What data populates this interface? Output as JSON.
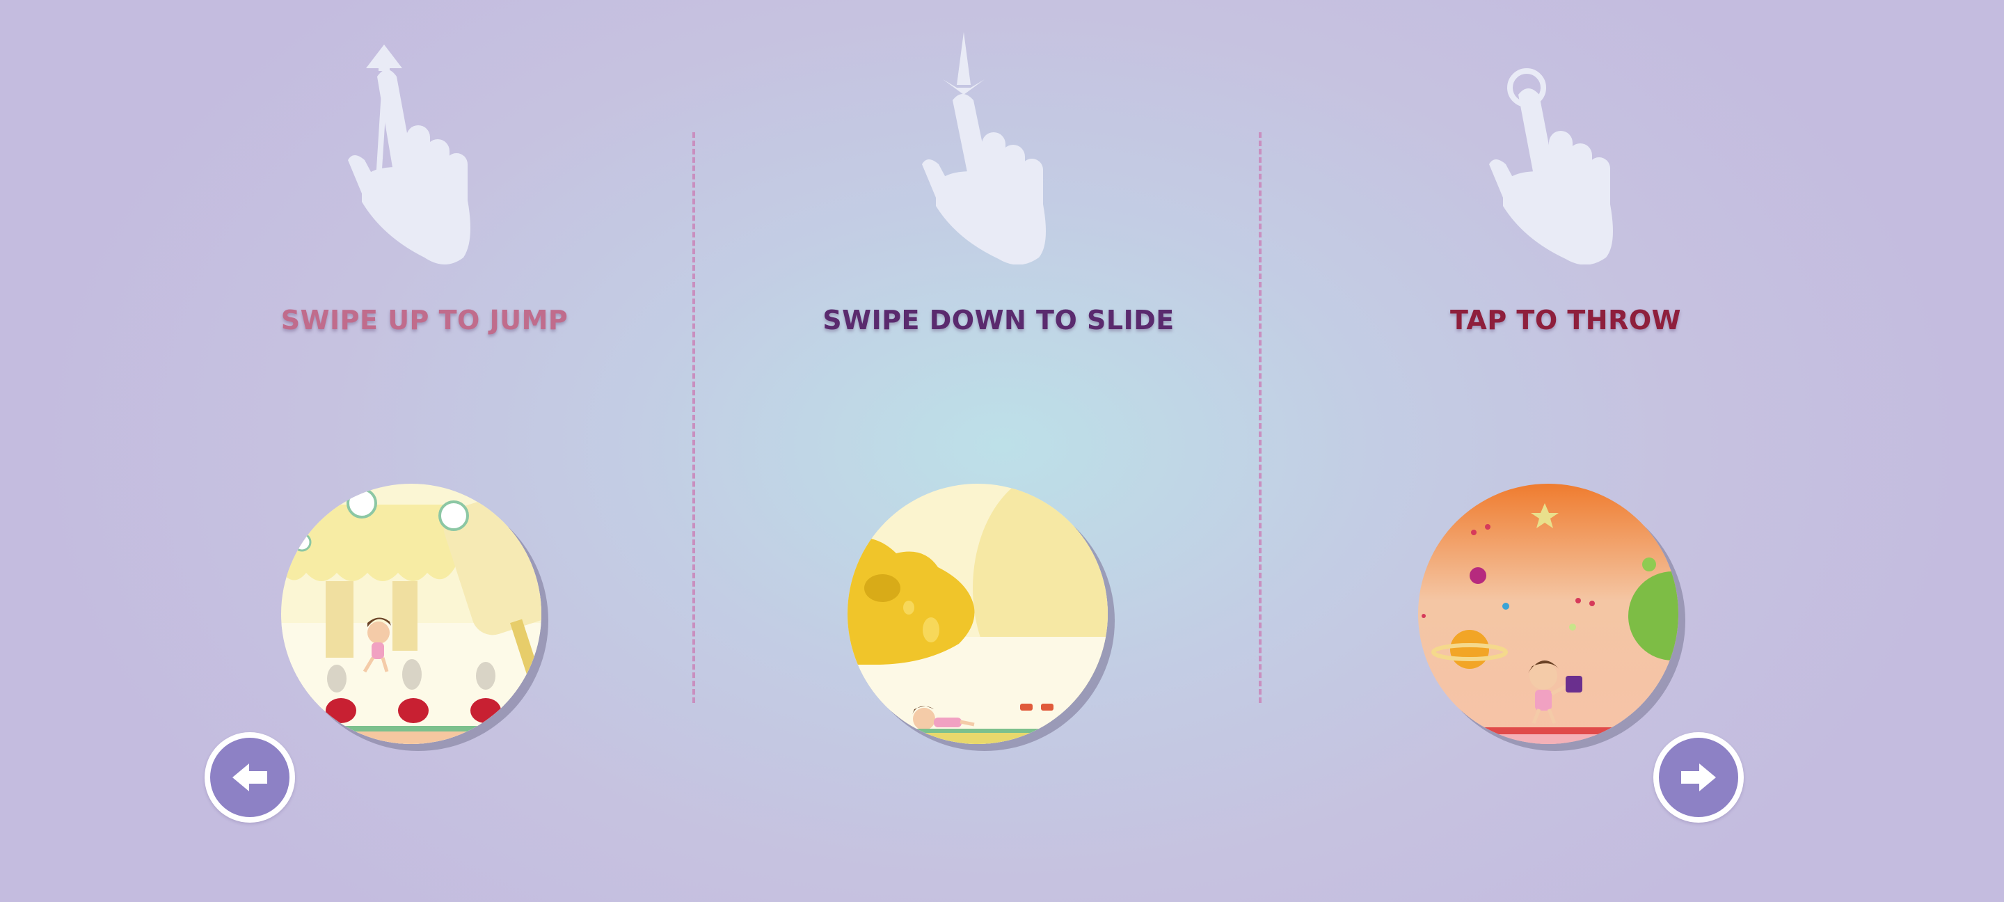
{
  "instructions": [
    {
      "title": "SWIPE UP TO JUMP",
      "title_color": "#c06c8c",
      "gesture_icon": "swipe-up-hand-icon",
      "scene": "jump-scene"
    },
    {
      "title": "SWIPE DOWN TO SLIDE",
      "title_color": "#5a2a6e",
      "gesture_icon": "swipe-down-hand-icon",
      "scene": "slide-scene"
    },
    {
      "title": "TAP TO THROW",
      "title_color": "#8e1f3c",
      "gesture_icon": "tap-hand-icon",
      "scene": "throw-scene"
    }
  ],
  "navigation": {
    "prev_icon": "arrow-left-icon",
    "next_icon": "arrow-right-icon",
    "button_color": "#8d81c5"
  },
  "colors": {
    "hand": "#e9ebf6",
    "divider": "#c98fbf"
  }
}
